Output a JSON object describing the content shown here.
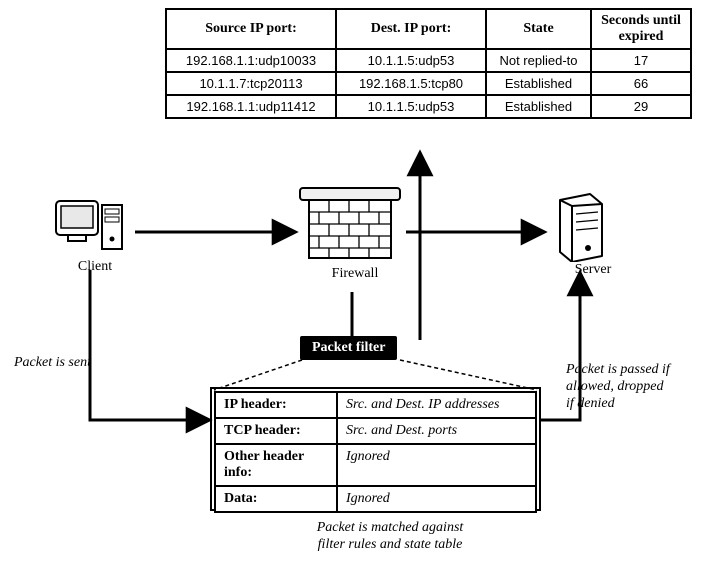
{
  "state_table": {
    "headers": [
      "Source IP port:",
      "Dest. IP port:",
      "State",
      "Seconds until\nexpired"
    ],
    "rows": [
      {
        "src": "192.168.1.1:udp10033",
        "dst": "10.1.1.5:udp53",
        "state": "Not replied-to",
        "ttl": "17"
      },
      {
        "src": "10.1.1.7:tcp20113",
        "dst": "192.168.1.5:tcp80",
        "state": "Established",
        "ttl": "66"
      },
      {
        "src": "192.168.1.1:udp11412",
        "dst": "10.1.1.5:udp53",
        "state": "Established",
        "ttl": "29"
      }
    ]
  },
  "nodes": {
    "client": "Client",
    "firewall": "Firewall",
    "server": "Server"
  },
  "packet_filter_label": "Packet filter",
  "packet_table": {
    "rows": [
      {
        "label": "IP header:",
        "value": "Src. and Dest. IP addresses"
      },
      {
        "label": "TCP header:",
        "value": "Src. and Dest. ports"
      },
      {
        "label": "Other header info:",
        "value": "Ignored"
      },
      {
        "label": "Data:",
        "value": "Ignored"
      }
    ]
  },
  "captions": {
    "packet_sent": "Packet is sent",
    "packet_passed": "Packet is passed if\nallowed, dropped\nif denied",
    "matched": "Packet is matched against\nfilter rules and state table"
  }
}
